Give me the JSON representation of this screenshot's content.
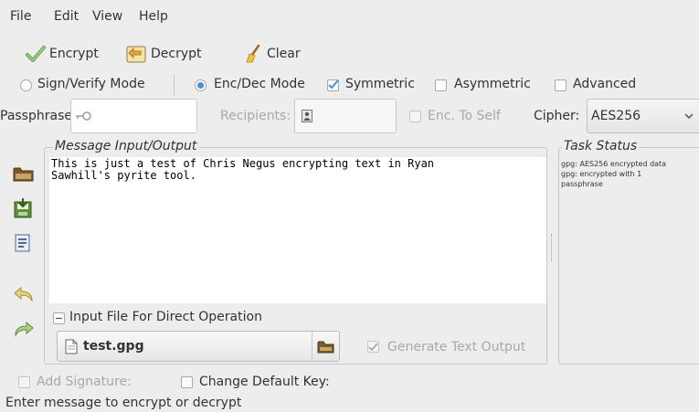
{
  "menu": {
    "file": "File",
    "edit": "Edit",
    "view": "View",
    "help": "Help"
  },
  "toolbar": {
    "encrypt": "Encrypt",
    "decrypt": "Decrypt",
    "clear": "Clear"
  },
  "modes": {
    "sign_verify": "Sign/Verify Mode",
    "enc_dec": "Enc/Dec Mode",
    "symmetric": "Symmetric",
    "asymmetric": "Asymmetric",
    "advanced": "Advanced",
    "selected_mode": "enc_dec",
    "symmetric_checked": true,
    "asymmetric_checked": false,
    "advanced_checked": false
  },
  "options": {
    "passphrase_label": "Passphrase:",
    "recipients_label": "Recipients:",
    "enc_to_self": "Enc. To Self",
    "cipher_label": "Cipher:",
    "cipher_value": "AES256"
  },
  "message": {
    "frame_title": "Message Input/Output",
    "text": "This is just a test of Chris Negus encrypting text in Ryan\nSawhill's pyrite tool."
  },
  "task_status": {
    "title": "Task Status",
    "text": "gpg: AES256 encrypted data\ngpg: encrypted with 1\npassphrase"
  },
  "input_file": {
    "expander_label": "Input File For Direct Operation",
    "filename": "test.gpg",
    "generate_text_output": "Generate Text Output",
    "generate_checked": true
  },
  "signature": {
    "add_signature": "Add Signature:",
    "change_default_key": "Change Default Key:"
  },
  "statusbar": {
    "text": "Enter message to encrypt or decrypt"
  },
  "colors": {
    "accent": "#4a90d9",
    "window_bg": "#ededed"
  }
}
